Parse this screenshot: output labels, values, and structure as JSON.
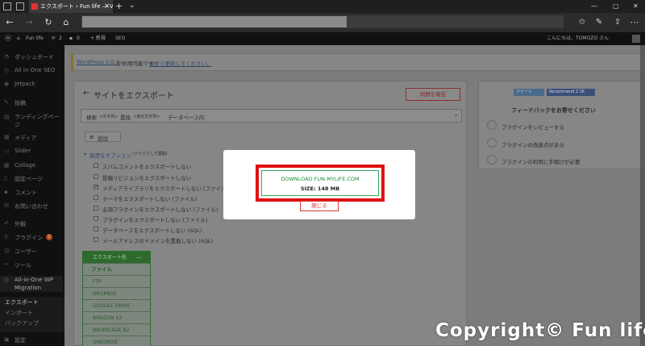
{
  "browser": {
    "tab_title": "エクスポート ‹ Fun life — V",
    "tab_close": "✕",
    "new_tab": "+",
    "tab_menu": "⌄",
    "window_controls": {
      "minimize": "—",
      "maximize": "▢",
      "close": "✕"
    }
  },
  "wp_bar": {
    "site": "Fun life",
    "comments": "2",
    "pending": "0",
    "new": "+ 新規",
    "seo": "SEO",
    "greeting": "こんにちは、TOMOZO さん"
  },
  "sidebar": {
    "items": [
      {
        "label": "ダッシュボード"
      },
      {
        "label": "All in One SEO"
      },
      {
        "label": "Jetpack"
      },
      {
        "label": "投稿"
      },
      {
        "label": "ランディングペー ジ"
      },
      {
        "label": "メディア"
      },
      {
        "label": "Slider"
      },
      {
        "label": "Collage"
      },
      {
        "label": "固定ページ"
      },
      {
        "label": "コメント"
      },
      {
        "label": "お問い合わせ"
      },
      {
        "label": "外観"
      },
      {
        "label": "プラグイン"
      },
      {
        "label": "ユーザー"
      },
      {
        "label": "ツール"
      },
      {
        "label": "All-in-One WP Migration"
      }
    ],
    "plugin_badge": "1",
    "submenu": [
      {
        "label": "エクスポート"
      },
      {
        "label": "インポート"
      },
      {
        "label": "バックアップ"
      }
    ],
    "settings": "設定"
  },
  "notice": {
    "text": "WordPress 5.0.3",
    "text2": " が利用可能です！",
    "link": "今すぐ更新してください。"
  },
  "export": {
    "title": "サイトをエクスポート",
    "report_button": "問題を報告",
    "search_label": "検索",
    "search_placeholder": "<文字列>",
    "replace_label": "置換",
    "replace_placeholder": "<他の文字列>",
    "db_label": "データベース内",
    "add_button": "追加",
    "advanced": "高度なオプション",
    "advanced_hint": "(クリックして展開)",
    "options": [
      {
        "label": "スパムコメントをエクスポートしない",
        "checked": false
      },
      {
        "label": "投稿リビジョンをエクスポートしない",
        "checked": false
      },
      {
        "label": "メディアライブラリをエクスポートしない (ファイル)",
        "checked": true
      },
      {
        "label": "テーマをエクスポートしない (ファイル)",
        "checked": false
      },
      {
        "label": "必須プラグインをエクスポートしない (ファイル)",
        "checked": false
      },
      {
        "label": "プラグインをエクスポートしない (ファイル)",
        "checked": false
      },
      {
        "label": "データベースをエクスポートしない (SQL)",
        "checked": false
      },
      {
        "label": "メールアドレスのドメインを置換しない (SQL)",
        "checked": false
      }
    ],
    "export_to": "エクスポート先",
    "destinations": [
      "ファイル",
      "FTP",
      "DROPBOX",
      "GOOGLE DRIVE",
      "AMAZON S3",
      "BACKBLAZE B2",
      "ONEDRIVE"
    ]
  },
  "feedback": {
    "tweet": "ツイート",
    "recommend": "Recommend 2.1K",
    "title": "フィードバックをお寄せください",
    "items": [
      "プラグインをレビューする",
      "プラグインの改善点がある",
      "プラグインの利用に手助けが必要"
    ]
  },
  "modal": {
    "download_label": "DOWNLOAD FUN-MYLIFE.COM",
    "size_label": "SIZE: 148 MB",
    "close_label": "閉じる"
  },
  "watermark": "Copyright© Fun life"
}
